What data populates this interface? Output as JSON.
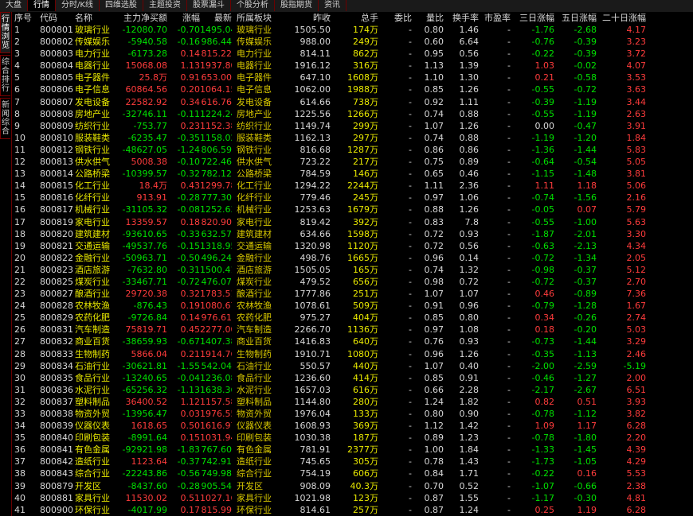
{
  "top_tabs": [
    "大盘",
    "行情",
    "分时/K线",
    "四维选股",
    "主题投资",
    "股票漏斗",
    "个股分析",
    "股指期货",
    "资讯"
  ],
  "active_top_tab": 1,
  "side_tabs": [
    "行情浏览",
    "综合排行",
    "新闻综合"
  ],
  "active_side_tab": 0,
  "columns": [
    "序号",
    "代码",
    "名称",
    "主力净买额",
    "涨幅",
    "最新",
    "所属板块",
    "昨收",
    "总手",
    "委比",
    "量比",
    "换手率",
    "市盈率",
    "三日涨幅",
    "五日涨幅",
    "二十日涨幅"
  ],
  "rows": [
    [
      "1",
      "800801",
      "玻璃行业",
      "-12080.70",
      "-0.70",
      "1495.04",
      "玻璃行业",
      "1505.50",
      "174万",
      "-",
      "0.80",
      "1.46",
      "-",
      "-1.76",
      "-2.68",
      "4.17"
    ],
    [
      "2",
      "800802",
      "传媒娱乐",
      "-5940.58",
      "-0.16",
      "986.44",
      "传媒娱乐",
      "988.00",
      "249万",
      "-",
      "0.60",
      "6.64",
      "-",
      "-0.76",
      "-0.39",
      "3.23"
    ],
    [
      "3",
      "800803",
      "电力行业",
      "-6173.28",
      "0.14",
      "815.22",
      "电力行业",
      "814.11",
      "862万",
      "-",
      "0.95",
      "0.56",
      "-",
      "-0.22",
      "-0.39",
      "3.72"
    ],
    [
      "4",
      "800804",
      "电器行业",
      "15068.08",
      "1.13",
      "1937.80",
      "电器行业",
      "1916.12",
      "316万",
      "-",
      "1.13",
      "1.39",
      "-",
      "1.03",
      "-0.02",
      "4.07"
    ],
    [
      "5",
      "800805",
      "电子器件",
      "25.8万",
      "0.91",
      "653.00",
      "电子器件",
      "647.10",
      "1608万",
      "-",
      "1.10",
      "1.30",
      "-",
      "0.21",
      "-0.58",
      "3.53"
    ],
    [
      "6",
      "800806",
      "电子信息",
      "60864.56",
      "0.20",
      "1064.15",
      "电子信息",
      "1062.00",
      "1988万",
      "-",
      "0.85",
      "1.26",
      "-",
      "-0.55",
      "-0.72",
      "3.63"
    ],
    [
      "7",
      "800807",
      "发电设备",
      "22582.92",
      "0.34",
      "616.76",
      "发电设备",
      "614.66",
      "738万",
      "-",
      "0.92",
      "1.11",
      "-",
      "-0.39",
      "-1.19",
      "3.44"
    ],
    [
      "8",
      "800808",
      "房地产业",
      "-32746.11",
      "-0.11",
      "1224.24",
      "房地产业",
      "1225.56",
      "1266万",
      "-",
      "0.74",
      "0.88",
      "-",
      "-0.55",
      "-1.19",
      "2.63"
    ],
    [
      "9",
      "800809",
      "纺织行业",
      "-753.77",
      "0.23",
      "1152.38",
      "纺织行业",
      "1149.74",
      "299万",
      "-",
      "1.07",
      "1.26",
      "-",
      "0.00",
      "-0.47",
      "3.91"
    ],
    [
      "10",
      "800810",
      "服装鞋类",
      "-6235.47",
      "-0.35",
      "1158.02",
      "服装鞋类",
      "1162.13",
      "297万",
      "-",
      "0.74",
      "0.88",
      "-",
      "-1.19",
      "-1.20",
      "1.84"
    ],
    [
      "11",
      "800812",
      "钢铁行业",
      "-48627.05",
      "-1.24",
      "806.59",
      "钢铁行业",
      "816.68",
      "1287万",
      "-",
      "0.86",
      "0.86",
      "-",
      "-1.36",
      "-1.44",
      "5.83"
    ],
    [
      "12",
      "800813",
      "供水供气",
      "5008.38",
      "-0.10",
      "722.46",
      "供水供气",
      "723.22",
      "217万",
      "-",
      "0.75",
      "0.89",
      "-",
      "-0.64",
      "-0.54",
      "5.05"
    ],
    [
      "13",
      "800814",
      "公路桥梁",
      "-10399.57",
      "-0.32",
      "782.12",
      "公路桥梁",
      "784.59",
      "146万",
      "-",
      "0.65",
      "0.46",
      "-",
      "-1.15",
      "-1.48",
      "3.81"
    ],
    [
      "14",
      "800815",
      "化工行业",
      "18.4万",
      "0.43",
      "1299.78",
      "化工行业",
      "1294.22",
      "2244万",
      "-",
      "1.11",
      "2.36",
      "-",
      "1.11",
      "1.18",
      "5.06"
    ],
    [
      "15",
      "800816",
      "化纤行业",
      "913.91",
      "-0.28",
      "777.30",
      "化纤行业",
      "779.46",
      "245万",
      "-",
      "0.97",
      "1.06",
      "-",
      "-0.74",
      "-1.56",
      "2.16"
    ],
    [
      "16",
      "800817",
      "机械行业",
      "-31105.32",
      "-0.08",
      "1252.63",
      "机械行业",
      "1253.63",
      "1679万",
      "-",
      "0.88",
      "1.26",
      "-",
      "-0.05",
      "0.07",
      "5.79"
    ],
    [
      "17",
      "800819",
      "家电行业",
      "13359.57",
      "0.18",
      "820.90",
      "家电行业",
      "819.42",
      "392万",
      "-",
      "0.83",
      "7.8",
      "-",
      "-0.55",
      "-1.00",
      "5.63"
    ],
    [
      "18",
      "800820",
      "建筑建材",
      "-93610.65",
      "-0.33",
      "632.57",
      "建筑建材",
      "634.66",
      "1598万",
      "-",
      "0.72",
      "0.93",
      "-",
      "-1.87",
      "-2.01",
      "3.30"
    ],
    [
      "19",
      "800821",
      "交通运输",
      "-49537.76",
      "-0.15",
      "1318.95",
      "交通运输",
      "1320.98",
      "1120万",
      "-",
      "0.72",
      "0.56",
      "-",
      "-0.63",
      "-2.13",
      "4.34"
    ],
    [
      "20",
      "800822",
      "金融行业",
      "-50963.71",
      "-0.50",
      "496.24",
      "金融行业",
      "498.76",
      "1665万",
      "-",
      "0.96",
      "0.14",
      "-",
      "-0.72",
      "-1.34",
      "2.05"
    ],
    [
      "21",
      "800823",
      "酒店旅游",
      "-7632.80",
      "-0.31",
      "1500.41",
      "酒店旅游",
      "1505.05",
      "165万",
      "-",
      "0.74",
      "1.32",
      "-",
      "-0.98",
      "-0.37",
      "5.12"
    ],
    [
      "22",
      "800825",
      "煤炭行业",
      "-33467.71",
      "-0.72",
      "476.07",
      "煤炭行业",
      "479.52",
      "656万",
      "-",
      "0.98",
      "0.72",
      "-",
      "-0.72",
      "-0.37",
      "2.70"
    ],
    [
      "23",
      "800827",
      "酿酒行业",
      "29720.38",
      "0.32",
      "1783.51",
      "酿酒行业",
      "1777.86",
      "251万",
      "-",
      "1.07",
      "1.07",
      "-",
      "0.46",
      "-0.89",
      "7.36"
    ],
    [
      "24",
      "800828",
      "农林牧渔",
      "-876.43",
      "0.19",
      "1080.67",
      "农林牧渔",
      "1078.61",
      "509万",
      "-",
      "0.91",
      "0.96",
      "-",
      "-0.79",
      "-1.28",
      "1.67"
    ],
    [
      "25",
      "800829",
      "农药化肥",
      "-9726.84",
      "0.14",
      "976.61",
      "农药化肥",
      "975.27",
      "404万",
      "-",
      "0.85",
      "0.80",
      "-",
      "0.34",
      "-0.26",
      "2.74"
    ],
    [
      "26",
      "800831",
      "汽车制造",
      "75819.71",
      "0.45",
      "2277.00",
      "汽车制造",
      "2266.70",
      "1136万",
      "-",
      "0.97",
      "1.08",
      "-",
      "0.18",
      "-0.20",
      "5.03"
    ],
    [
      "27",
      "800832",
      "商业百货",
      "-38659.93",
      "-0.67",
      "1407.38",
      "商业百货",
      "1416.83",
      "640万",
      "-",
      "0.76",
      "0.93",
      "-",
      "-0.73",
      "-1.44",
      "3.29"
    ],
    [
      "28",
      "800833",
      "生物制药",
      "5866.04",
      "0.21",
      "1914.76",
      "生物制药",
      "1910.71",
      "1080万",
      "-",
      "0.96",
      "1.26",
      "-",
      "-0.35",
      "-1.13",
      "2.46"
    ],
    [
      "29",
      "800834",
      "石油行业",
      "-30621.81",
      "-1.55",
      "542.04",
      "石油行业",
      "550.57",
      "440万",
      "-",
      "1.07",
      "0.40",
      "-",
      "-2.00",
      "-2.59",
      "-5.19"
    ],
    [
      "30",
      "800835",
      "食品行业",
      "-13240.65",
      "-0.04",
      "1236.08",
      "食品行业",
      "1236.60",
      "414万",
      "-",
      "0.85",
      "0.91",
      "-",
      "-0.46",
      "-1.27",
      "2.00"
    ],
    [
      "31",
      "800836",
      "水泥行业",
      "-65256.32",
      "-1.13",
      "1638.36",
      "水泥行业",
      "1657.03",
      "616万",
      "-",
      "0.66",
      "2.28",
      "-",
      "-2.17",
      "-2.67",
      "6.51"
    ],
    [
      "32",
      "800837",
      "塑料制品",
      "36400.52",
      "1.12",
      "1157.58",
      "塑料制品",
      "1144.80",
      "280万",
      "-",
      "1.24",
      "1.82",
      "-",
      "0.82",
      "0.51",
      "3.93"
    ],
    [
      "33",
      "800838",
      "物资外贸",
      "-13956.47",
      "0.03",
      "1976.55",
      "物资外贸",
      "1976.04",
      "133万",
      "-",
      "0.80",
      "0.90",
      "-",
      "-0.78",
      "-1.12",
      "3.82"
    ],
    [
      "34",
      "800839",
      "仪器仪表",
      "1618.65",
      "0.50",
      "1616.97",
      "仪器仪表",
      "1608.93",
      "369万",
      "-",
      "1.12",
      "1.42",
      "-",
      "1.09",
      "1.17",
      "6.28"
    ],
    [
      "35",
      "800840",
      "印刷包装",
      "-8991.64",
      "0.15",
      "1031.94",
      "印刷包装",
      "1030.38",
      "187万",
      "-",
      "0.89",
      "1.23",
      "-",
      "-0.78",
      "-1.80",
      "2.20"
    ],
    [
      "36",
      "800841",
      "有色金属",
      "-92921.98",
      "-1.83",
      "767.60",
      "有色金属",
      "781.91",
      "2377万",
      "-",
      "1.00",
      "1.84",
      "-",
      "-1.33",
      "-1.45",
      "4.39"
    ],
    [
      "37",
      "800842",
      "造纸行业",
      "1123.64",
      "-0.37",
      "742.91",
      "造纸行业",
      "745.65",
      "305万",
      "-",
      "0.78",
      "1.43",
      "-",
      "-1.73",
      "-1.05",
      "4.29"
    ],
    [
      "38",
      "800843",
      "综合行业",
      "-22243.86",
      "-0.56",
      "749.98",
      "综合行业",
      "754.19",
      "606万",
      "-",
      "0.84",
      "1.71",
      "-",
      "-0.22",
      "0.16",
      "5.53"
    ],
    [
      "39",
      "800879",
      "开发区",
      "-8437.60",
      "-0.28",
      "905.54",
      "开发区",
      "908.09",
      "40.3万",
      "-",
      "0.70",
      "0.52",
      "-",
      "-1.07",
      "-0.66",
      "2.38"
    ],
    [
      "40",
      "800881",
      "家具行业",
      "11530.02",
      "0.51",
      "1027.16",
      "家具行业",
      "1021.98",
      "123万",
      "-",
      "0.87",
      "1.55",
      "-",
      "-1.17",
      "-0.30",
      "4.81"
    ],
    [
      "41",
      "800900",
      "环保行业",
      "-4017.99",
      "0.17",
      "815.99",
      "环保行业",
      "814.61",
      "257万",
      "-",
      "0.87",
      "1.24",
      "-",
      "0.25",
      "1.19",
      "6.28"
    ]
  ],
  "colors": {
    "up": "#ff3c3c",
    "down": "#00e000",
    "neutral": "#d8d8d8",
    "volume": "#e8e800",
    "border": "#6b0000"
  }
}
